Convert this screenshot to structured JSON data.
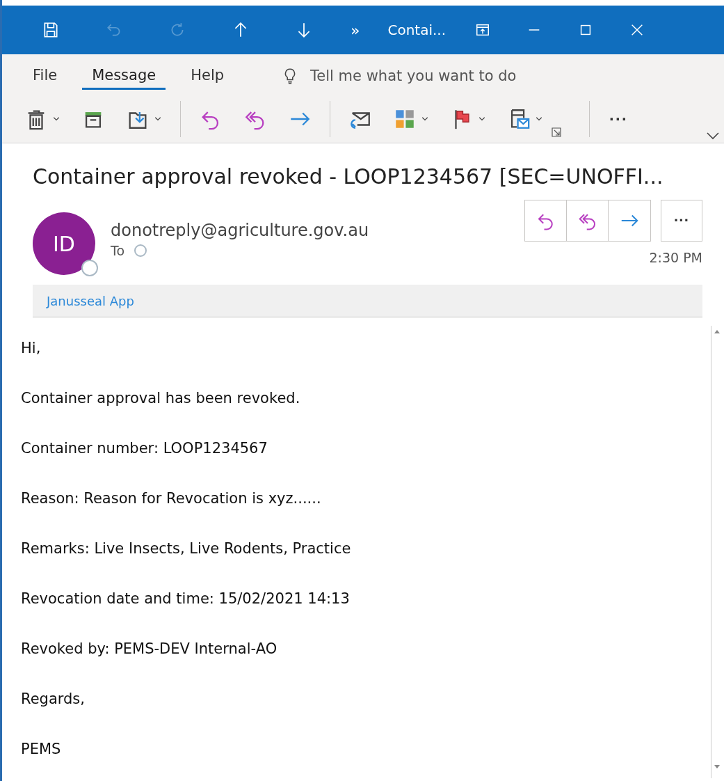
{
  "window": {
    "title": "Contai...",
    "quick_access": [
      {
        "kind": "save",
        "disabled": false
      },
      {
        "kind": "undo",
        "disabled": true
      },
      {
        "kind": "redo",
        "disabled": true
      },
      {
        "kind": "up",
        "disabled": false
      },
      {
        "kind": "down",
        "disabled": false
      }
    ],
    "overflow": "»"
  },
  "tabs": [
    {
      "label": "File",
      "selected": false
    },
    {
      "label": "Message",
      "selected": true
    },
    {
      "label": "Help",
      "selected": false
    }
  ],
  "search": {
    "placeholder": "Tell me what you want to do"
  },
  "toolbar": [
    [
      {
        "kind": "delete",
        "dropdown": true
      },
      {
        "kind": "archive",
        "dropdown": false
      },
      {
        "kind": "move",
        "dropdown": true
      }
    ],
    [
      {
        "kind": "reply",
        "dropdown": false
      },
      {
        "kind": "reply_all",
        "dropdown": false
      },
      {
        "kind": "forward",
        "dropdown": false
      }
    ],
    [
      {
        "kind": "unread",
        "dropdown": false
      },
      {
        "kind": "categorize",
        "dropdown": true
      },
      {
        "kind": "flag",
        "dropdown": true
      },
      {
        "kind": "assign",
        "dropdown": true
      }
    ]
  ],
  "toolbar_more": "···",
  "message": {
    "subject": "Container approval revoked - LOOP1234567 [SEC=UNOFFI...",
    "initials": "ID",
    "sender": "donotreply@agriculture.gov.au",
    "to_label": "To",
    "time": "2:30 PM",
    "more": "···",
    "addin": "Janusseal App",
    "body": [
      "Hi,",
      "Container approval has been revoked.",
      "Container number: LOOP1234567",
      "Reason: Reason for Revocation is xyz......",
      "Remarks: Live Insects, Live Rodents, Practice",
      "Revocation date and time: 15/02/2021 14:13",
      "Revoked by: PEMS-DEV Internal-AO",
      "Regards,",
      "PEMS"
    ]
  }
}
